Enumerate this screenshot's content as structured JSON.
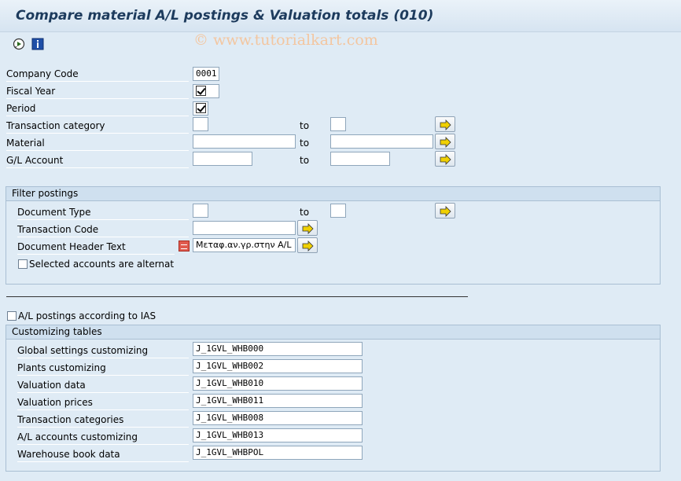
{
  "window": {
    "title": "Compare material A/L postings & Valuation totals (010)"
  },
  "toolbar": {
    "items": [
      {
        "icon": "execute-icon"
      },
      {
        "icon": "info-icon"
      }
    ]
  },
  "watermark": "© www.tutorialkart.com",
  "selection": {
    "company_code": {
      "label": "Company Code",
      "value": "0001"
    },
    "fiscal_year": {
      "label": "Fiscal Year",
      "value": "☑"
    },
    "period": {
      "label": "Period",
      "value": "☑"
    },
    "transaction_category": {
      "label": "Transaction category",
      "from": "",
      "to_label": "to",
      "to": ""
    },
    "material": {
      "label": "Material",
      "from": "",
      "to_label": "to",
      "to": ""
    },
    "gl_account": {
      "label": "G/L Account",
      "from": "",
      "to_label": "to",
      "to": ""
    }
  },
  "filter_postings": {
    "title": "Filter postings",
    "document_type": {
      "label": "Document Type",
      "from": "",
      "to_label": "to",
      "to": ""
    },
    "transaction_code": {
      "label": "Transaction Code",
      "value": ""
    },
    "document_header_text": {
      "label": "Document Header Text",
      "value": "Μεταφ.αν.γρ.στην A/L"
    },
    "selected_accounts": {
      "label": "Selected accounts are alternat",
      "checked": false
    }
  },
  "ias": {
    "label": "A/L postings according to IAS",
    "checked": false
  },
  "customizing_tables": {
    "title": "Customizing tables",
    "rows": [
      {
        "label": "Global settings customizing",
        "value": "J_1GVL_WHB000"
      },
      {
        "label": "Plants customizing",
        "value": "J_1GVL_WHB002"
      },
      {
        "label": "Valuation data",
        "value": "J_1GVL_WHB010"
      },
      {
        "label": "Valuation prices",
        "value": "J_1GVL_WHB011"
      },
      {
        "label": "Transaction categories",
        "value": "J_1GVL_WHB008"
      },
      {
        "label": "A/L accounts customizing",
        "value": "J_1GVL_WHB013"
      },
      {
        "label": "Warehouse book data",
        "value": "J_1GVL_WHBPOL"
      }
    ]
  },
  "colors": {
    "background": "#dfebf5",
    "title": "#1d3b5d",
    "group_header": "#cfe0ef",
    "arrow": "#f0d000"
  }
}
